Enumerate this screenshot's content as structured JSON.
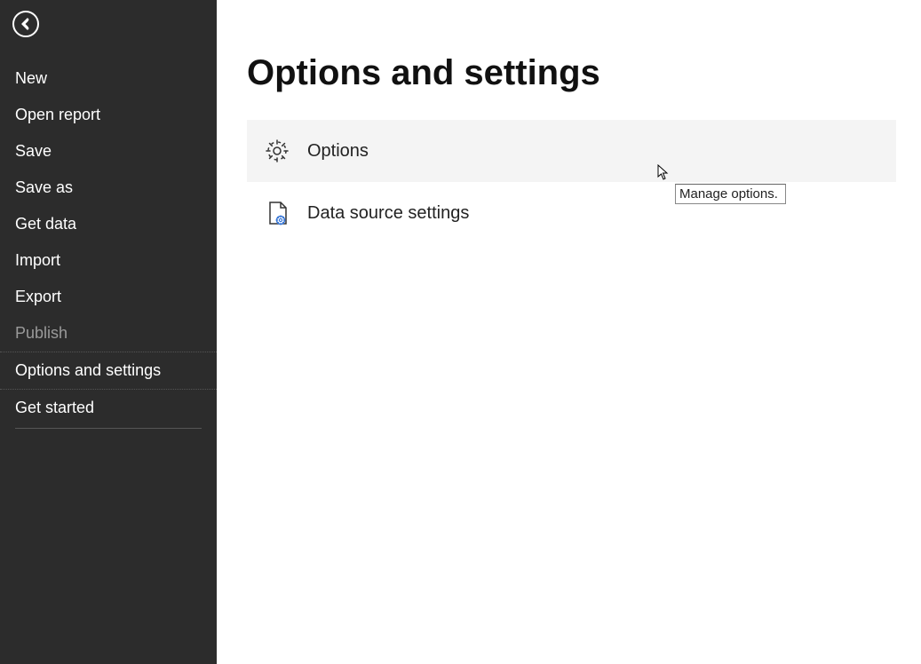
{
  "sidebar": {
    "items": [
      {
        "label": "New"
      },
      {
        "label": "Open report"
      },
      {
        "label": "Save"
      },
      {
        "label": "Save as"
      },
      {
        "label": "Get data"
      },
      {
        "label": "Import"
      },
      {
        "label": "Export"
      },
      {
        "label": "Publish"
      },
      {
        "label": "Options and settings"
      },
      {
        "label": "Get started"
      }
    ]
  },
  "main": {
    "title": "Options and settings",
    "items": [
      {
        "label": "Options"
      },
      {
        "label": "Data source settings"
      }
    ]
  },
  "tooltip": "Manage options."
}
